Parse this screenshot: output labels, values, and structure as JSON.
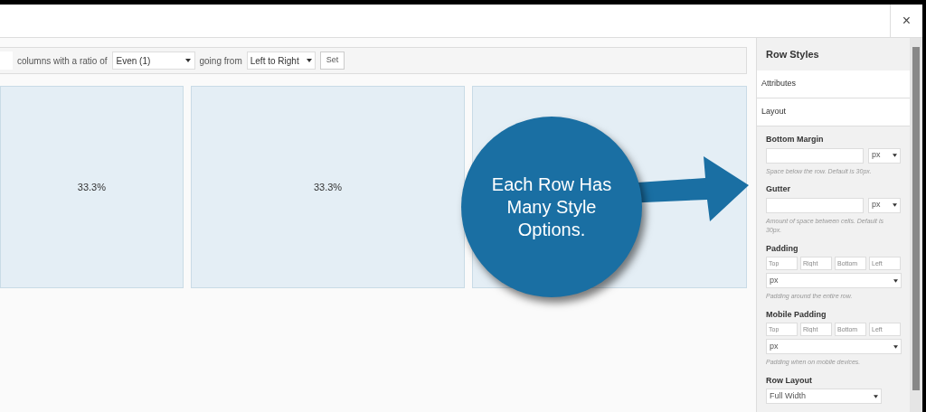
{
  "toolbar": {
    "text_1": "columns with a ratio of",
    "ratio": "Even (1)",
    "text_2": "going from",
    "direction": "Left to Right",
    "set_button": "Set"
  },
  "close_button": "×",
  "cells": [
    {
      "label": "33.3%"
    },
    {
      "label": "33.3%"
    },
    {}
  ],
  "sidebar": {
    "title": "Row Styles",
    "sections": [
      {
        "label": "Attributes"
      },
      {
        "label": "Layout"
      }
    ],
    "fields": [
      {
        "kind": "unit",
        "label": "Bottom Margin",
        "unit": "px",
        "help": "Space below the row. Default is 30px."
      },
      {
        "kind": "unit",
        "label": "Gutter",
        "unit": "px",
        "help": "Amount of space between cells. Default is 30px."
      },
      {
        "kind": "sides",
        "label": "Padding",
        "placeholders": [
          "Top",
          "Right",
          "Bottom",
          "Left"
        ],
        "unit": "px",
        "help": "Padding around the entire row."
      },
      {
        "kind": "sides",
        "label": "Mobile Padding",
        "placeholders": [
          "Top",
          "Right",
          "Bottom",
          "Left"
        ],
        "unit": "px",
        "help": "Padding when on mobile devices."
      },
      {
        "kind": "select",
        "label": "Row Layout",
        "value": "Full Width"
      }
    ]
  },
  "callout": {
    "text": "Each Row Has Many Style Options."
  }
}
